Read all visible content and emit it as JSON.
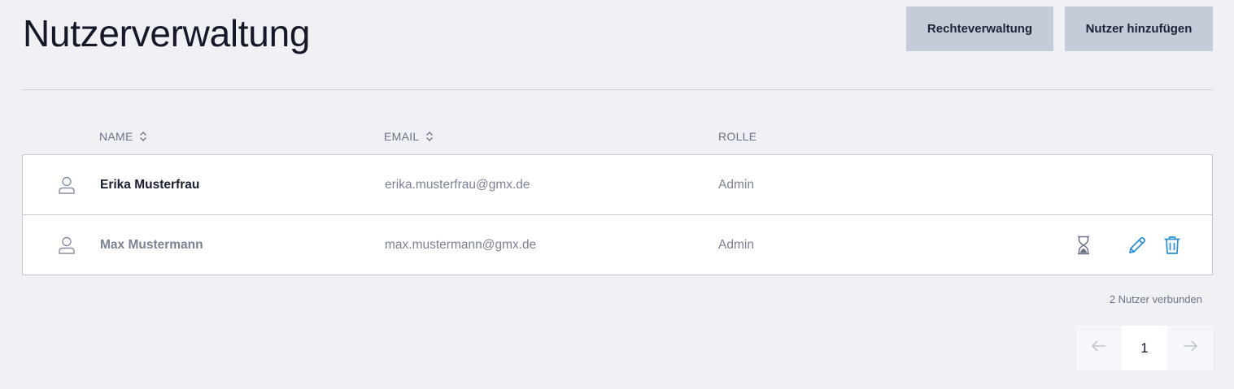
{
  "header": {
    "title": "Nutzerverwaltung",
    "rights_button": "Rechteverwaltung",
    "add_user_button": "Nutzer hinzufügen"
  },
  "table": {
    "columns": [
      "NAME",
      "EMAIL",
      "ROLLE"
    ],
    "rows": [
      {
        "name": "Erika Musterfrau",
        "email": "erika.musterfrau@gmx.de",
        "role": "Admin",
        "status": "active"
      },
      {
        "name": "Max Mustermann",
        "email": "max.mustermann@gmx.de",
        "role": "Admin",
        "status": "pending"
      }
    ]
  },
  "footer": {
    "count_text": "2 Nutzer verbunden",
    "pagination": {
      "current_page": "1"
    }
  },
  "colors": {
    "background": "#f0f1f5",
    "button": "#c5ccd9",
    "accent_icon": "#2d8ecf",
    "muted_text": "#7c8294"
  },
  "icons": {
    "avatar": "user-outline-icon",
    "sort": "sort-arrows-icon",
    "pending": "hourglass-icon",
    "edit": "pencil-icon",
    "delete": "trash-icon",
    "prev": "arrow-left-icon",
    "next": "arrow-right-icon"
  }
}
